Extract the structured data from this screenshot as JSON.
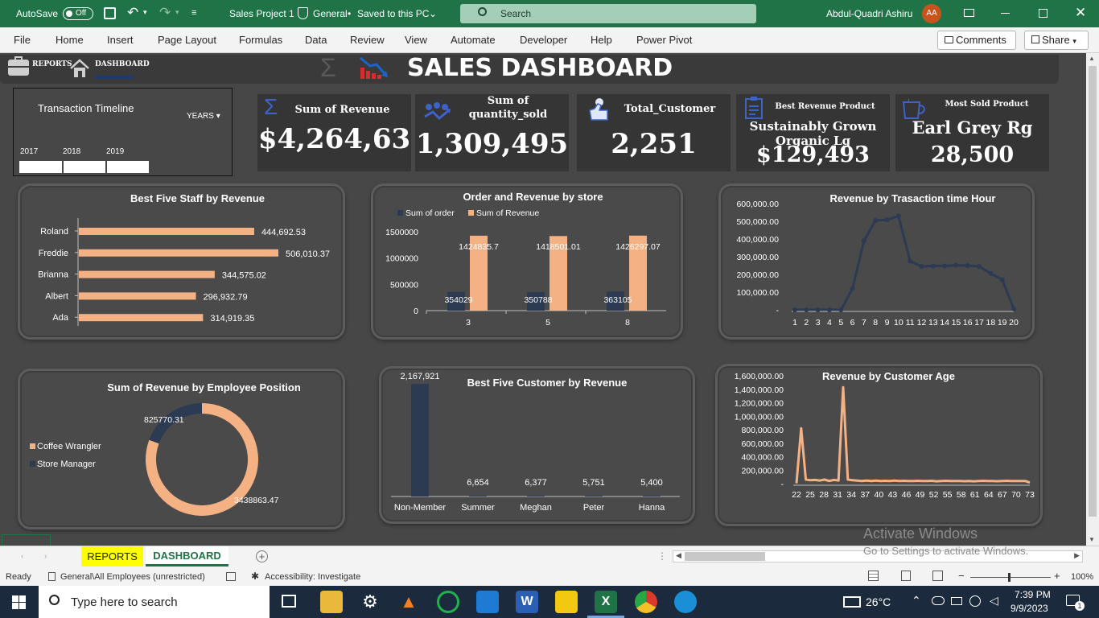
{
  "titlebar": {
    "autosave": "AutoSave",
    "autosave_state": "Off",
    "doc_title": "Sales Project 1",
    "label": "General",
    "saved": "Saved to this PC",
    "search": "Search",
    "user": "Abdul-Quadri Ashiru",
    "initials": "AA"
  },
  "ribbon": {
    "menus": [
      "File",
      "Home",
      "Insert",
      "Page Layout",
      "Formulas",
      "Data",
      "Review",
      "View",
      "Automate",
      "Developer",
      "Help",
      "Power Pivot"
    ],
    "comments": "Comments",
    "share": "Share"
  },
  "nav": {
    "reports": "REPORTS",
    "dashboard": "DASHBOARD"
  },
  "title": "SALES DASHBOARD",
  "slicer": {
    "title": "Transaction Timeline",
    "level": "YEARS",
    "years": [
      "2017",
      "2018",
      "2019"
    ]
  },
  "kpis": [
    {
      "label": "Sum of Revenue",
      "value": "$4,264,63"
    },
    {
      "label": "Sum of quantity_sold",
      "value": "1,309,495"
    },
    {
      "label": "Total_Customer",
      "value": "2,251"
    },
    {
      "label": "Best Revenue Product",
      "sub": "Sustainably Grown Organic Lg",
      "value": "$129,493"
    },
    {
      "label": "Most Sold Product",
      "sub": "Earl Grey Rg",
      "value": "28,500"
    }
  ],
  "colors": {
    "peach": "#f4b183",
    "navy": "#2c3a52",
    "card": "#353535",
    "excel_green": "#1f7346"
  },
  "chart_data": [
    {
      "type": "bar",
      "title": "Best Five Staff by Revenue",
      "orientation": "horizontal",
      "categories": [
        "Roland",
        "Freddie",
        "Brianna",
        "Albert",
        "Ada"
      ],
      "values": [
        444692.53,
        506010.37,
        344575.02,
        296932.79,
        314919.35
      ],
      "data_labels": [
        "444,692.53",
        "506,010.37",
        "344,575.02",
        "296,932.79",
        "314,919.35"
      ],
      "color": "#f4b183"
    },
    {
      "type": "bar",
      "title": "Order and Revenue by store",
      "categories": [
        "3",
        "5",
        "8"
      ],
      "series": [
        {
          "name": "Sum of order",
          "values": [
            354029,
            350788,
            363105
          ],
          "labels": [
            "354029",
            "350788",
            "363105"
          ],
          "color": "#2c3a52"
        },
        {
          "name": "Sum of Revenue",
          "values": [
            1424835.7,
            1418501.01,
            1426297.07
          ],
          "labels": [
            "1424835.7",
            "1418501.01",
            "1426297.07"
          ],
          "color": "#f4b183"
        }
      ],
      "yticks": [
        "0",
        "500000",
        "1000000",
        "1500000"
      ],
      "ylim": [
        0,
        1500000
      ],
      "legend": "top-left"
    },
    {
      "type": "line",
      "title": "Revenue by Trasaction time Hour",
      "x": [
        "1",
        "2",
        "3",
        "4",
        "5",
        "6",
        "7",
        "8",
        "9",
        "10",
        "11",
        "12",
        "13",
        "14",
        "15",
        "16",
        "17",
        "18",
        "19",
        "20"
      ],
      "values": [
        0,
        0,
        0,
        0,
        0,
        120000,
        390000,
        505000,
        508000,
        530000,
        275000,
        245000,
        248000,
        248000,
        252000,
        250000,
        245000,
        205000,
        170000,
        5000
      ],
      "yticks": [
        "-",
        "100,000.00",
        "200,000.00",
        "300,000.00",
        "400,000.00",
        "500,000.00",
        "600,000.00"
      ],
      "ylim": [
        0,
        600000
      ],
      "color": "#2c3a52"
    },
    {
      "type": "pie",
      "title": "Sum of Revenue by Employee Position",
      "categories": [
        "Coffee Wrangler",
        "Store Manager"
      ],
      "values": [
        3438863.47,
        825770.31
      ],
      "labels": [
        "3438863.47",
        "825770.31"
      ],
      "colors": [
        "#f4b183",
        "#2c3a52"
      ],
      "legend": "left"
    },
    {
      "type": "bar",
      "title": "Best Five Customer by Revenue",
      "categories": [
        "Non-Member",
        "Summer",
        "Meghan",
        "Peter",
        "Hanna"
      ],
      "values": [
        2167921,
        6654,
        6377,
        5751,
        5400
      ],
      "data_labels": [
        "2,167,921",
        "6,654",
        "6,377",
        "5,751",
        "5,400"
      ],
      "color": "#2c3a52"
    },
    {
      "type": "line",
      "title": "Revenue by Customer Age",
      "x": [
        "22",
        "25",
        "28",
        "31",
        "34",
        "37",
        "40",
        "43",
        "46",
        "49",
        "52",
        "55",
        "58",
        "61",
        "64",
        "67",
        "70",
        "73"
      ],
      "values": [
        5000,
        820000,
        60000,
        50000,
        55000,
        45000,
        60000,
        40000,
        55000,
        45000,
        1430000,
        60000,
        50000,
        45000,
        40000,
        45000,
        40000,
        45000,
        40000,
        42000,
        38000,
        45000,
        40000,
        42000,
        38000,
        40000,
        42000,
        38000,
        40000,
        42000,
        35000,
        40000,
        42000,
        38000,
        40000,
        38000,
        36000,
        40000,
        35000,
        38000,
        42000,
        40000,
        38000,
        36000,
        40000,
        42000,
        38000,
        40000,
        38000,
        40000,
        15000
      ],
      "yticks": [
        "-",
        "200,000.00",
        "400,000.00",
        "600,000.00",
        "800,000.00",
        "1,000,000.00",
        "1,200,000.00",
        "1,400,000.00",
        "1,600,000.00"
      ],
      "ylim": [
        0,
        1600000
      ],
      "color": "#f4b183"
    }
  ],
  "sheets": {
    "reports": "REPORTS",
    "dashboard": "DASHBOARD"
  },
  "watermark": {
    "line1": "Activate Windows",
    "line2": "Go to Settings to activate Windows."
  },
  "status": {
    "ready": "Ready",
    "sensitivity": "General\\All Employees (unrestricted)",
    "accessibility": "Accessibility: Investigate",
    "zoom": "100%"
  },
  "taskbar": {
    "search": "Type here to search",
    "weather": "26°C",
    "time": "7:39 PM",
    "date": "9/9/2023",
    "notifications": "1"
  }
}
